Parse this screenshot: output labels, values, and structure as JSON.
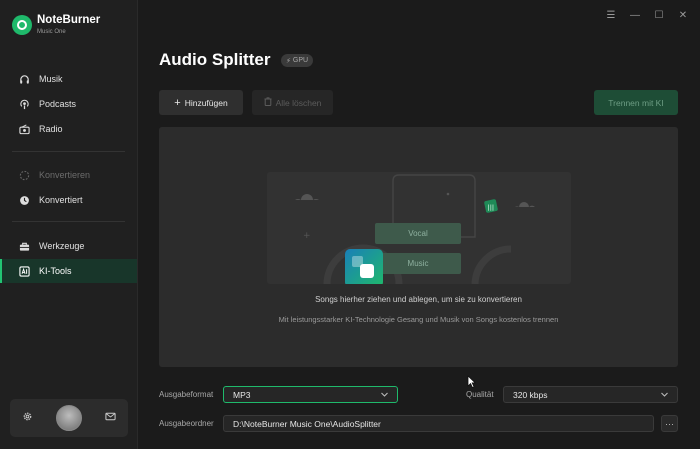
{
  "app": {
    "name": "NoteBurner",
    "subtitle": "Music One"
  },
  "sidebar": {
    "items": [
      {
        "label": "Musik",
        "icon": "headphones-icon"
      },
      {
        "label": "Podcasts",
        "icon": "podcast-icon"
      },
      {
        "label": "Radio",
        "icon": "radio-icon"
      },
      {
        "label": "Konvertieren",
        "icon": "convert-icon",
        "disabled": true
      },
      {
        "label": "Konvertiert",
        "icon": "clock-icon"
      },
      {
        "label": "Werkzeuge",
        "icon": "toolbox-icon"
      },
      {
        "label": "KI-Tools",
        "icon": "ai-icon",
        "active": true
      }
    ]
  },
  "header": {
    "title": "Audio Splitter",
    "badge": "GPU"
  },
  "toolbar": {
    "add_label": "Hinzufügen",
    "delete_label": "Alle löschen",
    "split_label": "Trennen mit KI"
  },
  "dropzone": {
    "vocal_label": "Vocal",
    "music_label": "Music",
    "primary_text": "Songs hierher ziehen und ablegen, um sie zu konvertieren",
    "secondary_text": "Mit leistungsstarker KI-Technologie Gesang und Musik von Songs kostenlos trennen"
  },
  "settings": {
    "format_label": "Ausgabeformat",
    "format_value": "MP3",
    "quality_label": "Qualität",
    "quality_value": "320 kbps",
    "folder_label": "Ausgabeordner",
    "folder_value": "D:\\NoteBurner Music One\\AudioSplitter",
    "browse_label": "···"
  },
  "colors": {
    "accent": "#1fb96b",
    "background": "#1b1b1b",
    "sidebar": "#202020"
  }
}
